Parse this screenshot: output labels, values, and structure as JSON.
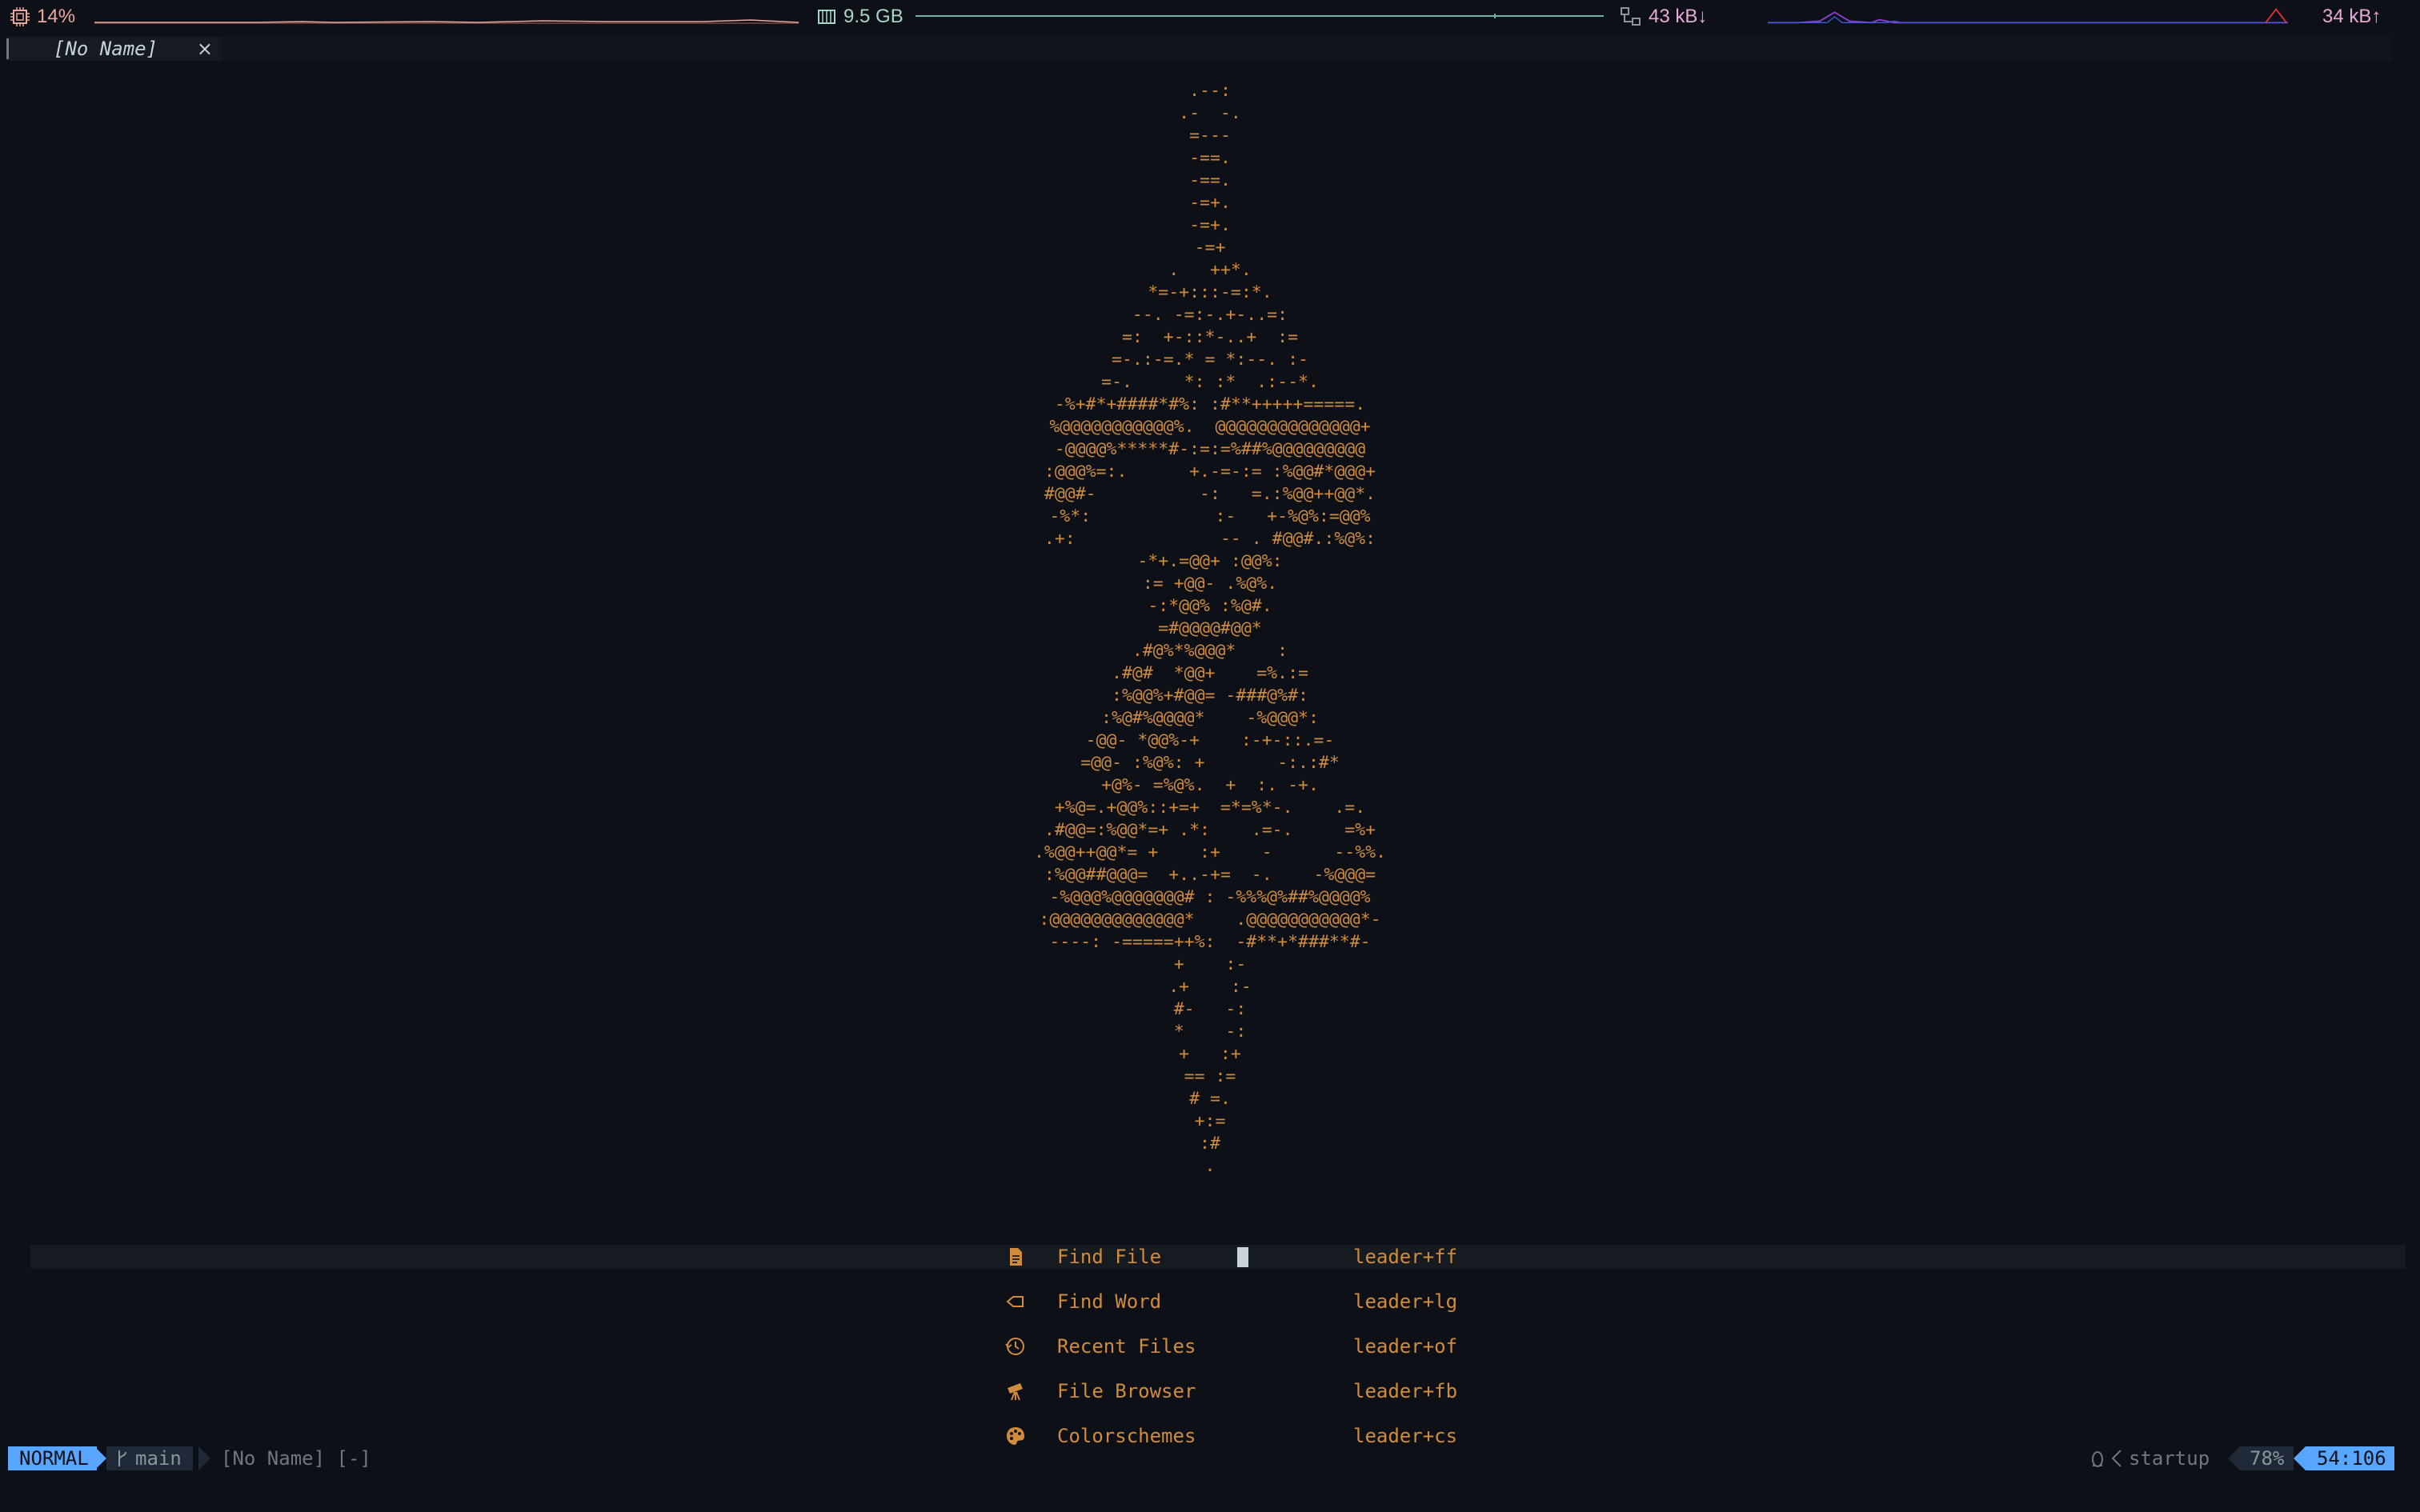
{
  "sysbar": {
    "cpu": {
      "icon": "cpu-icon",
      "value": "14%",
      "color": "#e9a8a0"
    },
    "memory": {
      "icon": "memory-icon",
      "value": "9.5 GB",
      "color": "#a5d6c7"
    },
    "net_down": {
      "icon": "network-icon",
      "value": "43 kB↓",
      "color": "#e9a8d8"
    },
    "net_up": {
      "value": "34 kB↑",
      "color": "#e9a8d8"
    }
  },
  "tab": {
    "label": "[No Name]",
    "close": "×"
  },
  "art": {
    "color": "#d08b3c",
    "lines": [
      ".--:",
      ".-  -.",
      "=---",
      "-==.",
      "-==.",
      "-=+.",
      "-=+.",
      "-=+",
      ".   ++*.",
      "*=-+:::-=:*.",
      "--. -=:-.+-..=:",
      "=:  +-::*-..+  :=",
      "=-.:-=.* = *:--. :-",
      "=-.     *: :*  .:--*.",
      "-%+#*+####*#%: :#**+++++=====.",
      "%@@@@@@@@@@@%.  @@@@@@@@@@@@@@+",
      "-@@@@%*****#-:=:=%##%@@@@@@@@@",
      ":@@@%=:.      +.-=-:= :%@@#*@@@+",
      "#@@#-          -:   =.:%@@++@@*.",
      "-%*:            :-   +-%@%:=@@%",
      ".+:              -- . #@@#.:%@%:",
      "-*+.=@@+ :@@%:",
      ":= +@@- .%@%.",
      "-:*@@% :%@#.",
      "=#@@@@#@@*",
      ".#@%*%@@@*    :",
      ".#@#  *@@+    =%.:=",
      ":%@@%+#@@= -###@%#:",
      ":%@#%@@@@*    -%@@@*:",
      "-@@- *@@%-+    :-+-::.=-",
      "=@@- :%@%: +       -:.:#*",
      "+@%- =%@%.  +  :. -+.",
      "+%@=.+@@%::+=+  =*=%*-.    .=.",
      ".#@@=:%@@*=+ .*:    .=-.     =%+",
      ".%@@++@@*= +    :+    -      --%%.",
      ":%@@##@@@=  +..-+=  -.    -%@@@=",
      "-%@@@%@@@@@@@# : -%%%@%##%@@@@%",
      ":@@@@@@@@@@@@@*    .@@@@@@@@@@@*-",
      "----: -=====++%:  -#**+*###**#-",
      "+    :-",
      ".+    :-",
      "#-   -:",
      "*    -:",
      "+   :+",
      "== :=",
      "# =.",
      "+:=",
      ":#",
      "."
    ]
  },
  "menu": {
    "items": [
      {
        "icon": "file-icon",
        "label": "Find File",
        "key": "leader+ff"
      },
      {
        "icon": "search-icon",
        "label": "Find Word",
        "key": "leader+lg"
      },
      {
        "icon": "history-icon",
        "label": "Recent Files",
        "key": "leader+of"
      },
      {
        "icon": "telescope-icon",
        "label": "File Browser",
        "key": "leader+fb"
      },
      {
        "icon": "palette-icon",
        "label": "Colorschemes",
        "key": "leader+cs"
      }
    ]
  },
  "status": {
    "mode": "NORMAL",
    "branch": "main",
    "file": "[No Name] [-]",
    "lsp": "startup",
    "percent": "78%",
    "position": "54:106",
    "accent": "#58a6ff"
  }
}
